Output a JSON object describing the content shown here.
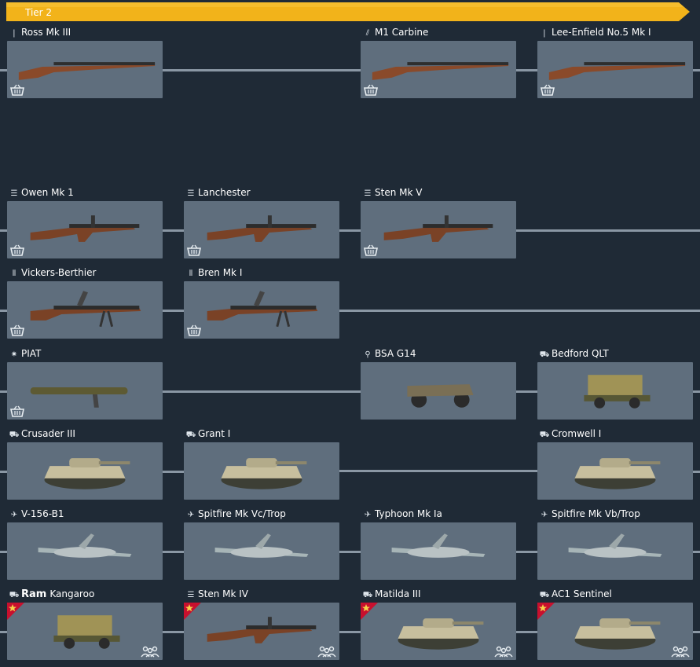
{
  "tier": {
    "label": "Tier 2",
    "bar_color": "#f2b31a"
  },
  "colors": {
    "background": "#1f2a36",
    "card": "#5f6e7d",
    "premium": "#c8102e"
  },
  "rows": [
    [
      {
        "name": "Ross Mk III",
        "icon": "rifle-icon",
        "buy": true
      },
      null,
      {
        "name": "M1 Carbine",
        "icon": "carbine-icon",
        "buy": true
      },
      {
        "name": "Lee-Enfield No.5 Mk I",
        "icon": "rifle-icon",
        "buy": true
      }
    ],
    [
      {
        "name": "Owen Mk 1",
        "icon": "smg-icon",
        "buy": true
      },
      {
        "name": "Lanchester",
        "icon": "smg-icon",
        "buy": true
      },
      {
        "name": "Sten Mk V",
        "icon": "smg-icon",
        "buy": true
      },
      null
    ],
    [
      {
        "name": "Vickers-Berthier",
        "icon": "machinegun-icon",
        "buy": true
      },
      {
        "name": "Bren Mk I",
        "icon": "machinegun-icon",
        "buy": true
      },
      null,
      null
    ],
    [
      {
        "name": "PIAT",
        "icon": "explosive-icon",
        "buy": true
      },
      null,
      {
        "name": "BSA G14",
        "icon": "motorcycle-icon"
      },
      {
        "name": "Bedford QLT",
        "icon": "vehicle-icon"
      }
    ],
    [
      {
        "name": "Crusader III",
        "icon": "tank-icon"
      },
      {
        "name": "Grant I",
        "icon": "tank-icon"
      },
      null,
      {
        "name": "Cromwell I",
        "icon": "tank-icon"
      }
    ],
    [
      {
        "name": "V-156-B1",
        "icon": "plane-icon"
      },
      {
        "name": "Spitfire Mk Vc/Trop",
        "icon": "plane-icon"
      },
      {
        "name": "Typhoon Mk Ia",
        "icon": "plane-icon"
      },
      {
        "name": "Spitfire Mk Vb/Trop",
        "icon": "plane-icon"
      }
    ],
    [
      {
        "name": "Kangaroo",
        "prefix": "Ram",
        "icon": "vehicle-icon",
        "premium": true
      },
      {
        "name": "Sten Mk IV",
        "icon": "smg-icon",
        "premium": true
      },
      {
        "name": "Matilda III",
        "icon": "tank-icon",
        "premium": true
      },
      {
        "name": "AC1 Sentinel",
        "icon": "tank-icon",
        "premium": true
      }
    ]
  ]
}
